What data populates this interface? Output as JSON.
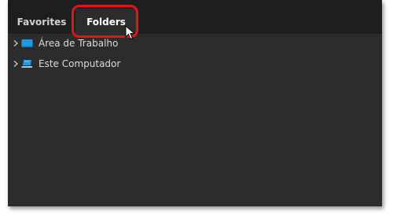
{
  "tabs": [
    {
      "label": "Favorites",
      "selected": false
    },
    {
      "label": "Folders",
      "selected": true
    }
  ],
  "tree": {
    "items": [
      {
        "label": "Área de Trabalho",
        "icon": "desktop-icon",
        "expanded": false
      },
      {
        "label": "Este Computador",
        "icon": "computer-icon",
        "expanded": false
      }
    ]
  },
  "colors": {
    "panel_bg": "#2c2c2c",
    "tabbar_bg": "#1e1e1e",
    "highlight": "#e0141c",
    "icon_blue": "#1e9be0"
  }
}
